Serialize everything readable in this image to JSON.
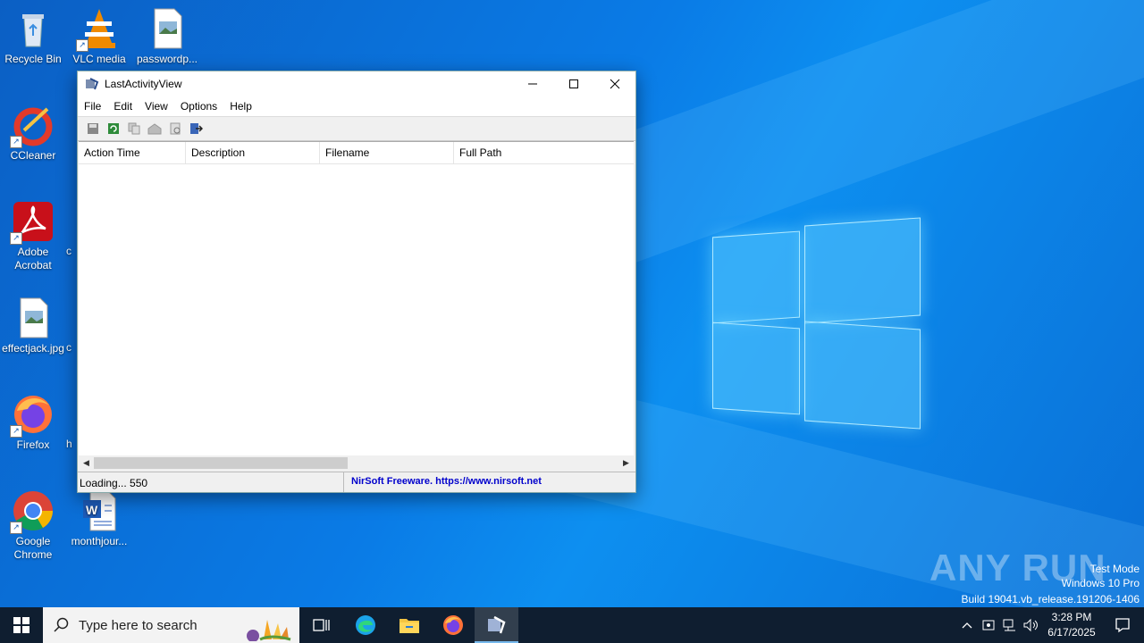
{
  "desktop": {
    "icons": [
      {
        "label": "Recycle Bin"
      },
      {
        "label": "VLC media"
      },
      {
        "label": "passwordp..."
      },
      {
        "label": "CCleaner"
      },
      {
        "label": "Adobe\nAcrobat"
      },
      {
        "label": "effectjack.jpg"
      },
      {
        "label": "Firefox"
      },
      {
        "label": "Google\nChrome"
      },
      {
        "label": "monthjour..."
      }
    ],
    "partial_labels": [
      "c",
      "c",
      "h"
    ]
  },
  "window": {
    "title": "LastActivityView",
    "menu": [
      "File",
      "Edit",
      "View",
      "Options",
      "Help"
    ],
    "columns": [
      "Action Time",
      "Description",
      "Filename",
      "Full Path"
    ],
    "status_left": "Loading... 550",
    "status_right": "NirSoft Freeware. https://www.nirsoft.net"
  },
  "watermark": {
    "brand": "ANY RUN",
    "line1": "Test Mode",
    "line2": "Windows 10 Pro",
    "line3": "Build 19041.vb_release.191206-1406"
  },
  "taskbar": {
    "search_placeholder": "Type here to search",
    "time": "3:28 PM",
    "date": "6/17/2025"
  },
  "colors": {
    "desktop_bg": "#0a6fd6",
    "taskbar_bg": "#0f1e30",
    "link_blue": "#0000cc"
  }
}
